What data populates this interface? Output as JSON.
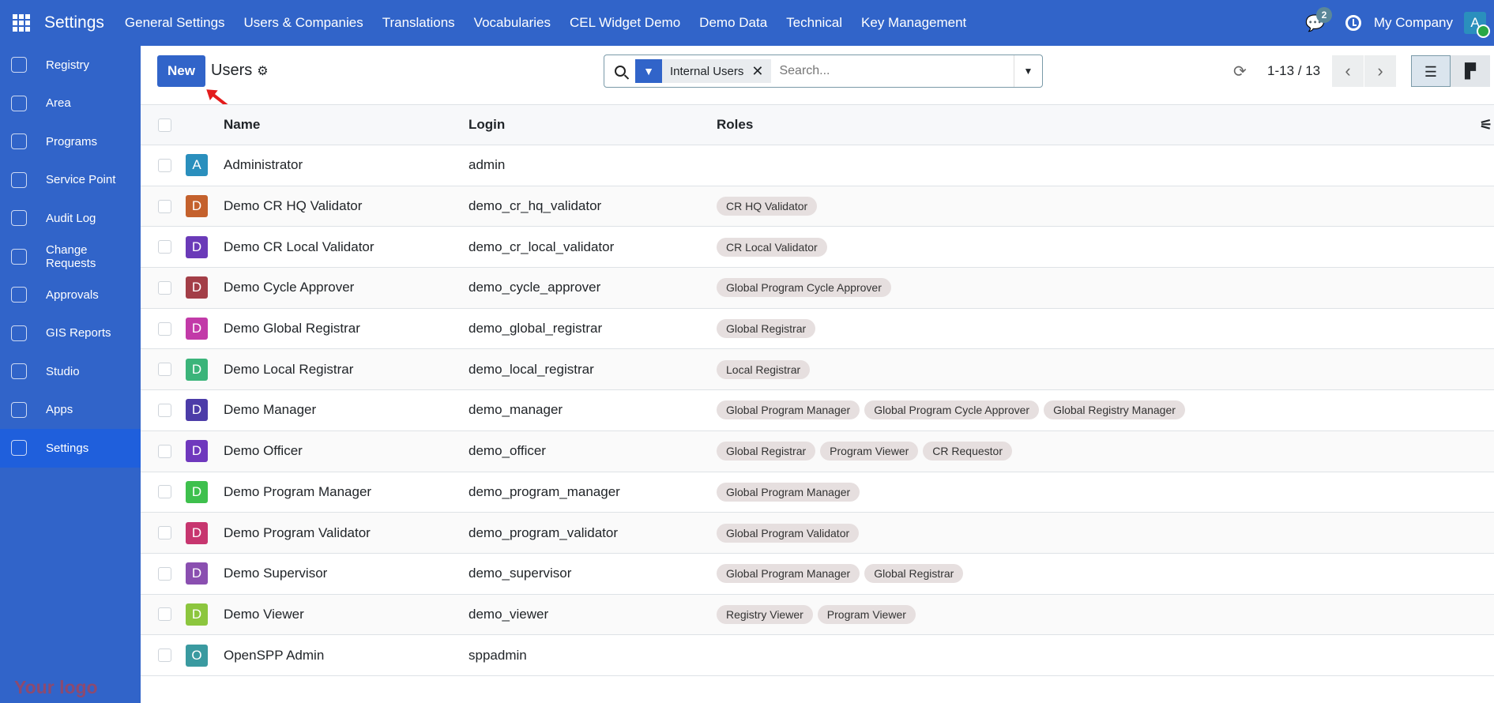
{
  "topbar": {
    "app_title": "Settings",
    "menus": [
      "General Settings",
      "Users & Companies",
      "Translations",
      "Vocabularies",
      "CEL Widget Demo",
      "Demo Data",
      "Technical",
      "Key Management"
    ],
    "messages_count": "2",
    "company": "My Company",
    "user_initial": "A"
  },
  "sidebar": {
    "items": [
      {
        "label": "Registry",
        "icon": "registry-icon"
      },
      {
        "label": "Area",
        "icon": "area-icon"
      },
      {
        "label": "Programs",
        "icon": "programs-icon"
      },
      {
        "label": "Service Point",
        "icon": "service-point-icon"
      },
      {
        "label": "Audit Log",
        "icon": "audit-log-icon"
      },
      {
        "label": "Change Requests",
        "icon": "change-requests-icon"
      },
      {
        "label": "Approvals",
        "icon": "approvals-icon"
      },
      {
        "label": "GIS Reports",
        "icon": "gis-reports-icon"
      },
      {
        "label": "Studio",
        "icon": "studio-icon"
      },
      {
        "label": "Apps",
        "icon": "apps-icon"
      },
      {
        "label": "Settings",
        "icon": "gear-icon",
        "active": true
      }
    ],
    "logo": "Your logo"
  },
  "control": {
    "new_label": "New",
    "title": "Users",
    "facet": "Internal Users",
    "search_placeholder": "Search...",
    "pager": "1-13 / 13"
  },
  "table": {
    "columns": [
      "Name",
      "Login",
      "Roles"
    ],
    "rows": [
      {
        "initial": "A",
        "color": "#2a8fbd",
        "name": "Administrator",
        "login": "admin",
        "roles": []
      },
      {
        "initial": "D",
        "color": "#c4612d",
        "name": "Demo CR HQ Validator",
        "login": "demo_cr_hq_validator",
        "roles": [
          "CR HQ Validator"
        ]
      },
      {
        "initial": "D",
        "color": "#6a3ab8",
        "name": "Demo CR Local Validator",
        "login": "demo_cr_local_validator",
        "roles": [
          "CR Local Validator"
        ]
      },
      {
        "initial": "D",
        "color": "#a33e47",
        "name": "Demo Cycle Approver",
        "login": "demo_cycle_approver",
        "roles": [
          "Global Program Cycle Approver"
        ]
      },
      {
        "initial": "D",
        "color": "#c23aa8",
        "name": "Demo Global Registrar",
        "login": "demo_global_registrar",
        "roles": [
          "Global Registrar"
        ]
      },
      {
        "initial": "D",
        "color": "#3bb47a",
        "name": "Demo Local Registrar",
        "login": "demo_local_registrar",
        "roles": [
          "Local Registrar"
        ]
      },
      {
        "initial": "D",
        "color": "#4c3ca8",
        "name": "Demo Manager",
        "login": "demo_manager",
        "roles": [
          "Global Program Manager",
          "Global Program Cycle Approver",
          "Global Registry Manager"
        ]
      },
      {
        "initial": "D",
        "color": "#6f38bd",
        "name": "Demo Officer",
        "login": "demo_officer",
        "roles": [
          "Global Registrar",
          "Program Viewer",
          "CR Requestor"
        ]
      },
      {
        "initial": "D",
        "color": "#3ec04d",
        "name": "Demo Program Manager",
        "login": "demo_program_manager",
        "roles": [
          "Global Program Manager"
        ]
      },
      {
        "initial": "D",
        "color": "#c7366f",
        "name": "Demo Program Validator",
        "login": "demo_program_validator",
        "roles": [
          "Global Program Validator"
        ]
      },
      {
        "initial": "D",
        "color": "#8a4fb0",
        "name": "Demo Supervisor",
        "login": "demo_supervisor",
        "roles": [
          "Global Program Manager",
          "Global Registrar"
        ]
      },
      {
        "initial": "D",
        "color": "#8cc63e",
        "name": "Demo Viewer",
        "login": "demo_viewer",
        "roles": [
          "Registry Viewer",
          "Program Viewer"
        ]
      },
      {
        "initial": "O",
        "color": "#3a9aa0",
        "name": "OpenSPP Admin",
        "login": "sppadmin",
        "roles": []
      }
    ]
  }
}
